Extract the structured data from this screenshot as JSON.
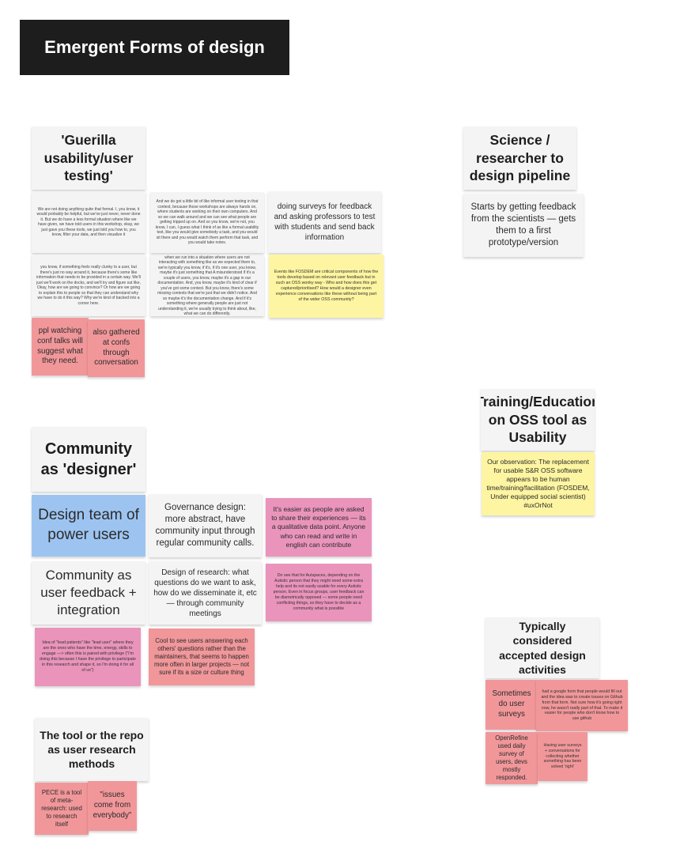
{
  "board_title": "Emergent Forms of design",
  "sections": {
    "guerilla": {
      "title": "'Guerilla usability/user testing'",
      "note_1": "We are not doing anything quite that formal. I, you know, it would probably be helpful, but we've just never, never done it. But we do have a less formal situation where like we have given, we have told users in this workshop, okay, we just gave you these tools, we just told you how to, you know, filter your data, and then visualize it",
      "note_2": "And we do get a little bit of like informal user testing in that context, because those workshops are always hands on, where students are working on their own computers. And so we can walk around and we can see what people are getting tripped up on. And so you know, we're not, you know, I can, I guess what I think of as like a formal usability test, like you would give somebody a task, and you would sit there and you would watch them perform that task, and you would take notes.",
      "note_3": "doing surveys for feedback and asking professors to test with students and send back information",
      "note_4": "you know, if something feels really clunky to a user, but there's just no way around it, because there's some like information that needs to be provided in a certain way. We'll just we'll work on the docks, and we'll try and figure out like, Okay, how are we going to convince? Or how are we going to explain this to people so that they can understand why we have to do it this way? Why we're kind of backed into a corner here.",
      "note_5": "when we run into a situation where users are not interacting with something like as we expected them to, we're typically you know, if it's, if it's one user, you know, maybe it's just something that A misunderstood if it's a couple of users, you know, maybe it's a gap in our documentation. And, you know, maybe it's kind of clear if you've got some context. But you know, there's some missing contexts that we're just that we didn't notice. And so maybe it's the documentation change. And if it's something where generally people are just not understanding it, we're usually trying to think about, like, what we can do differently.",
      "note_6": "Events like FOSDEM are critical components of how the tools develop based on relevant user feedback but in such an OSS wonky way - Who and how does this get captured/prioritised? How would a designer even experience conversations like these without being part of the wider OSS community?",
      "note_7": "ppl watching conf talks will suggest what they need.",
      "note_8": "also gathered at confs through conversation"
    },
    "science": {
      "title": "Science / researcher to design pipeline",
      "note_1": "Starts by getting feedback from the scientists — gets them to a first prototype/version"
    },
    "training": {
      "title": "Training/Education on OSS tool as Usability",
      "note_1": "Our observation: The replacement for usable S&R OSS software appears to be human time/training/facilitation (FOSDEM, Under equipped social scientist) #uxOrNot"
    },
    "community": {
      "title": "Community as 'designer'",
      "note_1": "Design team of power users",
      "note_2": "Governance design: more abstract, have community input through regular community calls.",
      "note_3": "It's easier as people are asked to share their experiences — its a qualitative data point. Anyone who can read and write in english can contribute",
      "note_4": "Community as user feedback + integration",
      "note_5": "Design of research: what questions do we want to ask, how do we disseminate it, etc — through community meetings",
      "note_6": "Do see that for Autspaces, depending on the Autistic person that they might need some extra help and its not easily usable for every Autistic person. Even in focus groups, user feedback can be diametrically opposed — some people need conflicting things, so they have to decide as a community what is possible",
      "note_7": "Idea of \"lead patients\" like \"lead user\" where they are the ones who have the time, energy, skills to engage —> often this is paired with privilege (\"I'm doing this because I have the privilege to participate in this research and shape it, so I'm doing it for all of us\")",
      "note_8": "Cool to see users answering each others' questions rather than the maintainers, that seems to happen more often in larger projects — not sure if its a size or culture thing"
    },
    "typical": {
      "title": "Typically considered accepted design activities",
      "note_1": "Sometimes do user surveys",
      "note_2": "had a google form that people would fill out and the idea was to create issues on Github from that form. Not sure how it's going right now, he wasn't really part of that. To make it easier for people who don't know how to use github",
      "note_3": "OpenRefine used daily survey of users, devs mostly responded.",
      "note_4": "Having user surveys + conversations for collecting whether something has been solved 'right'"
    },
    "tool": {
      "title": "The tool or the repo as user research methods",
      "note_1": "PECE is a tool of meta-research: used to research itself",
      "note_2": "\"issues come from everybody\""
    }
  },
  "colors": {
    "white": "#f4f4f4",
    "yellow": "#fdf5a1",
    "red": "#f1979a",
    "pink": "#ea94bc",
    "blue": "#9dc4f1",
    "banner": "#1d1d1d"
  }
}
